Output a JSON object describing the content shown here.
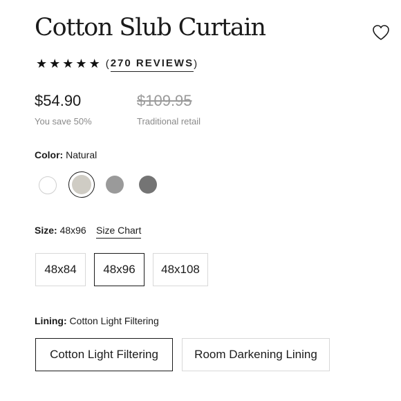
{
  "product": {
    "title": "Cotton Slub Curtain",
    "rating_stars": 5,
    "reviews_label": "270 REVIEWS"
  },
  "pricing": {
    "current": "$54.90",
    "savings": "You save 50%",
    "original": "$109.95",
    "original_label": "Traditional retail"
  },
  "color": {
    "label": "Color:",
    "selected": "Natural",
    "swatches": [
      {
        "name": "white",
        "hex": "#ffffff"
      },
      {
        "name": "natural",
        "hex": "#cfccc4",
        "selected": true
      },
      {
        "name": "grey",
        "hex": "#9a9a9a"
      },
      {
        "name": "charcoal",
        "hex": "#747474"
      }
    ]
  },
  "size": {
    "label": "Size:",
    "selected": "48x96",
    "chart_link": "Size Chart",
    "options": [
      "48x84",
      "48x96",
      "48x108"
    ]
  },
  "lining": {
    "label": "Lining:",
    "selected": "Cotton Light Filtering",
    "options": [
      "Cotton Light Filtering",
      "Room Darkening Lining"
    ]
  },
  "icons": {
    "favorite": "heart-icon",
    "star": "star-icon"
  }
}
